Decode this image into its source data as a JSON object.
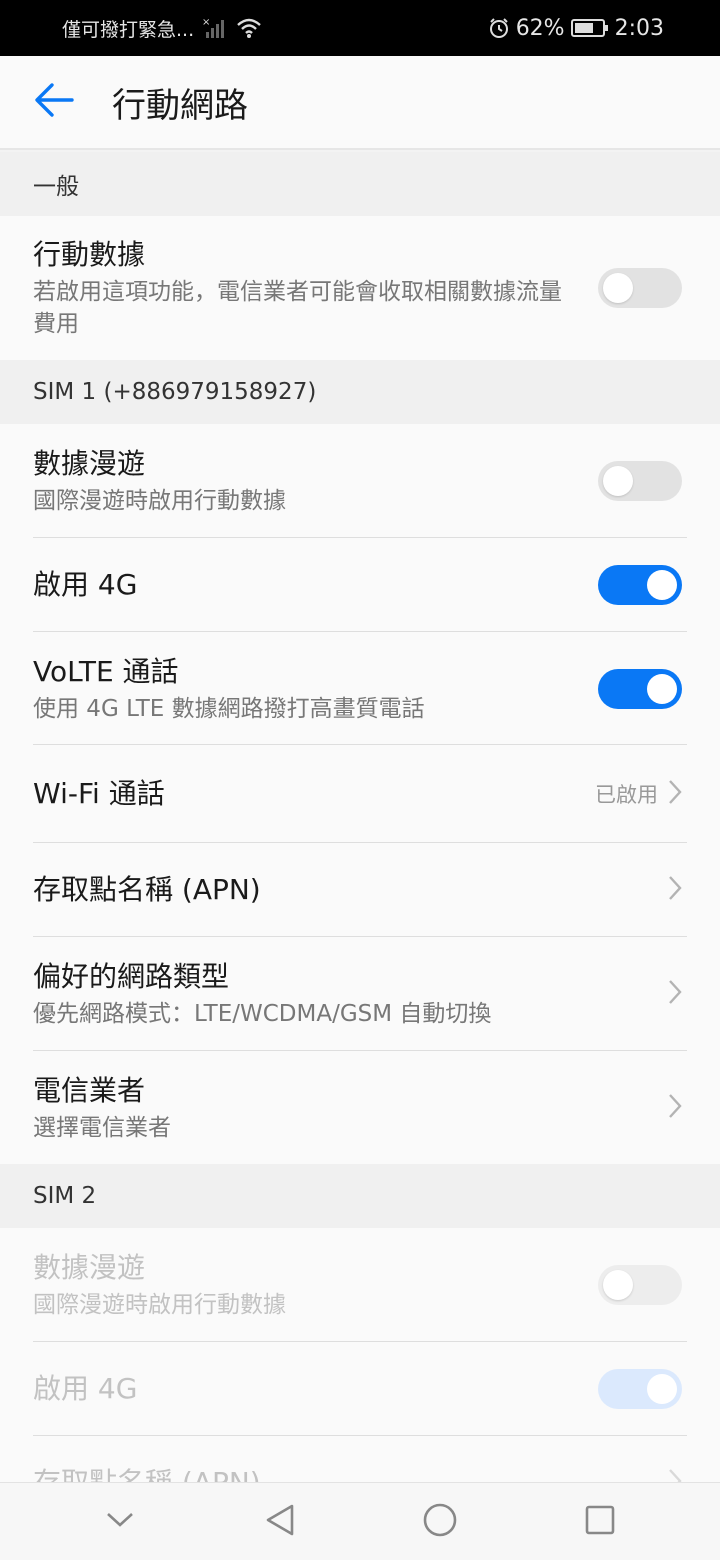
{
  "status_bar": {
    "carrier_text": "僅可撥打緊急...",
    "battery_percent": "62%",
    "time": "2:03"
  },
  "header": {
    "title": "行動網路",
    "back_icon": "arrow-left-icon"
  },
  "sections": {
    "general": {
      "header": "一般",
      "mobile_data": {
        "title": "行動數據",
        "subtitle": "若啟用這項功能，電信業者可能會收取相關數據流量費用",
        "enabled": false
      }
    },
    "sim1": {
      "header": "SIM 1 (+886979158927)",
      "data_roaming": {
        "title": "數據漫遊",
        "subtitle": "國際漫遊時啟用行動數據",
        "enabled": false
      },
      "enable_4g": {
        "title": "啟用 4G",
        "enabled": true
      },
      "volte": {
        "title": "VoLTE 通話",
        "subtitle": "使用 4G LTE 數據網路撥打高畫質電話",
        "enabled": true
      },
      "wifi_calling": {
        "title": "Wi-Fi 通話",
        "value": "已啟用"
      },
      "apn": {
        "title": "存取點名稱 (APN)"
      },
      "preferred_network": {
        "title": "偏好的網路類型",
        "subtitle": "優先網路模式：LTE/WCDMA/GSM 自動切換"
      },
      "carrier": {
        "title": "電信業者",
        "subtitle": "選擇電信業者"
      }
    },
    "sim2": {
      "header": "SIM 2",
      "data_roaming": {
        "title": "數據漫遊",
        "subtitle": "國際漫遊時啟用行動數據",
        "enabled": false
      },
      "enable_4g": {
        "title": "啟用 4G",
        "enabled": true
      },
      "apn": {
        "title": "存取點名稱 (APN)"
      }
    }
  },
  "nav_bar": {
    "icons": [
      "chevron-down-icon",
      "back-triangle-icon",
      "home-circle-icon",
      "recents-square-icon"
    ]
  },
  "colors": {
    "accent": "#0a78f5",
    "toggle_off": "#e2e2e2",
    "background": "#f3f3f3"
  }
}
